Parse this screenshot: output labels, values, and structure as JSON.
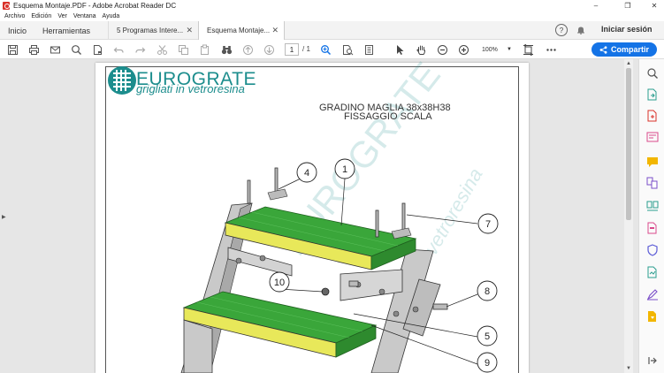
{
  "window": {
    "title": "Esquema Montaje.PDF - Adobe Acrobat Reader DC",
    "minimize": "–",
    "maximize": "❐",
    "close": "✕"
  },
  "menu": [
    "Archivo",
    "Edición",
    "Ver",
    "Ventana",
    "Ayuda"
  ],
  "tabs": {
    "home": "Inicio",
    "tools": "Herramientas",
    "docs": [
      {
        "label": "5 Programas Intere...",
        "close": "✕"
      },
      {
        "label": "Esquema Montaje...",
        "close": "✕"
      }
    ],
    "help": "?",
    "signin": "Iniciar sesión"
  },
  "toolbar": {
    "page_current": "1",
    "page_total": "/ 1",
    "zoom": "100%",
    "share_label": "Compartir"
  },
  "document": {
    "brand": "EUROGRATE",
    "tagline": "grigliati in vetroresina",
    "title_line1": "GRADINO MAGLIA 38x38H38",
    "title_line2": "FISSAGGIO SCALA",
    "watermark": "EUROGRATE",
    "watermark_sub": "vetroresina",
    "callouts": [
      "1",
      "4",
      "7",
      "10",
      "8",
      "5",
      "9"
    ]
  },
  "colors": {
    "accent": "#1473e6",
    "brand_teal": "#1c8d8d",
    "grate_green": "#3aa63a",
    "nosing_yellow": "#e8e85a",
    "steel": "#bfbfbf"
  }
}
